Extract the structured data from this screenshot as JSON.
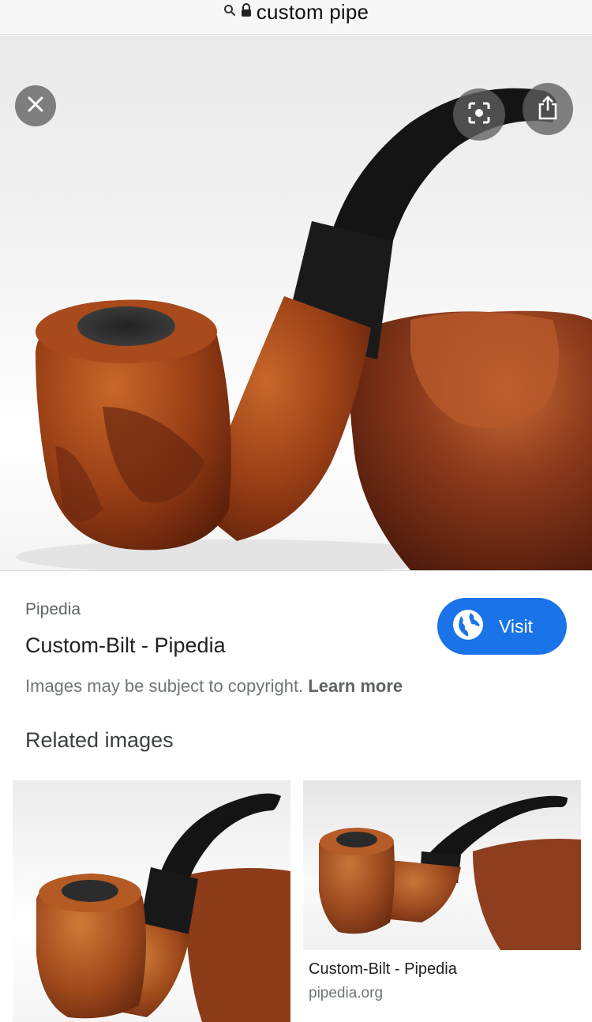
{
  "urlbar": {
    "text": "custom pipe",
    "icons": [
      "search-icon",
      "lock-icon"
    ]
  },
  "hero": {
    "image_subject": "",
    "buttons": [
      "close-icon",
      "lens-icon",
      "share-icon"
    ]
  },
  "result": {
    "source": "Pipedia",
    "title": "Custom-Bilt - Pipedia",
    "visit_label": "Visit",
    "visit_icon": "globe-icon",
    "copyright_text": "Images may be subject to copyright.",
    "learn_more": "Learn more"
  },
  "related": {
    "heading": "Related images",
    "items": [
      {
        "title": "",
        "domain": ""
      },
      {
        "title": "Custom-Bilt - Pipedia",
        "domain": "pipedia.org"
      }
    ]
  },
  "colors": {
    "accent": "#1a73e8",
    "text_primary": "#202124",
    "text_secondary": "#70757a"
  }
}
